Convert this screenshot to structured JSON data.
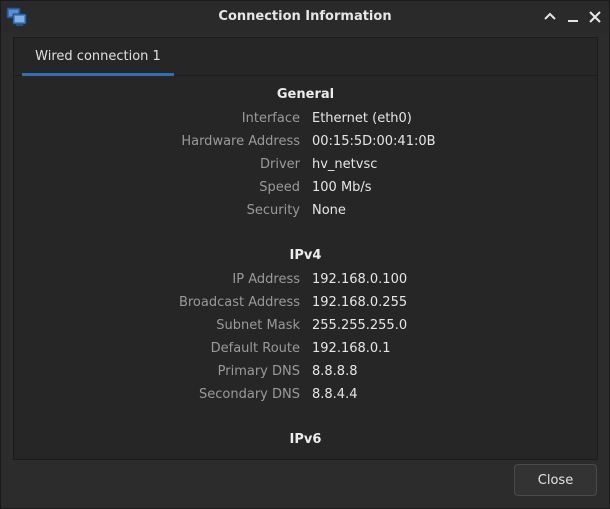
{
  "window": {
    "title": "Connection Information"
  },
  "tabs": [
    {
      "label": "Wired connection 1",
      "active": true
    }
  ],
  "general": {
    "heading": "General",
    "rows": [
      {
        "label": "Interface",
        "value": "Ethernet (eth0)"
      },
      {
        "label": "Hardware Address",
        "value": "00:15:5D:00:41:0B"
      },
      {
        "label": "Driver",
        "value": "hv_netvsc"
      },
      {
        "label": "Speed",
        "value": "100 Mb/s"
      },
      {
        "label": "Security",
        "value": "None"
      }
    ]
  },
  "ipv4": {
    "heading": "IPv4",
    "rows": [
      {
        "label": "IP Address",
        "value": "192.168.0.100"
      },
      {
        "label": "Broadcast Address",
        "value": "192.168.0.255"
      },
      {
        "label": "Subnet Mask",
        "value": "255.255.255.0"
      },
      {
        "label": "Default Route",
        "value": "192.168.0.1"
      },
      {
        "label": "Primary DNS",
        "value": "8.8.8.8"
      },
      {
        "label": "Secondary DNS",
        "value": "8.8.4.4"
      }
    ]
  },
  "ipv6": {
    "heading": "IPv6"
  },
  "footer": {
    "close_label": "Close"
  },
  "icons": {
    "app": "network-connections-icon",
    "minimize_up": "chevron-up-icon",
    "minimize": "minimize-icon",
    "close": "close-icon"
  },
  "colors": {
    "accent": "#2f6fb3",
    "label": "#9a9a9a",
    "value": "#e6e6e6"
  }
}
